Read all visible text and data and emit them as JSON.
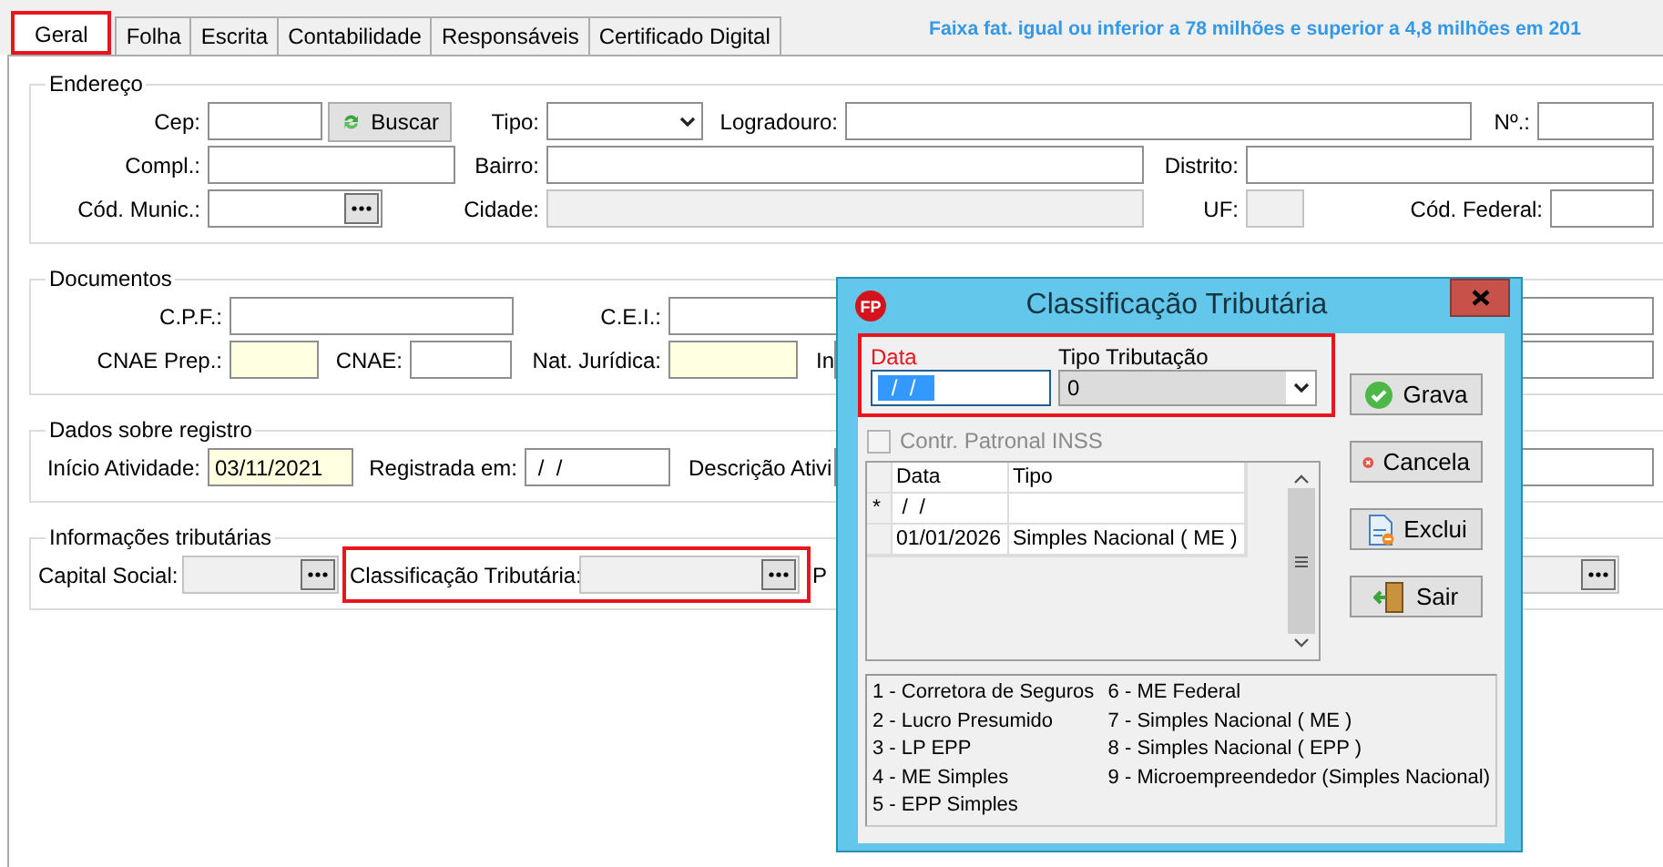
{
  "tabs": [
    {
      "label": "Geral",
      "selected": true,
      "highlighted": true
    },
    {
      "label": "Folha",
      "selected": false,
      "highlighted": false
    },
    {
      "label": "Escrita",
      "selected": false,
      "highlighted": false
    },
    {
      "label": "Contabilidade",
      "selected": false,
      "highlighted": false
    },
    {
      "label": "Responsáveis",
      "selected": false,
      "highlighted": false
    },
    {
      "label": "Certificado Digital",
      "selected": false,
      "highlighted": false
    }
  ],
  "notice": "Faixa fat. igual ou inferior a 78 milhões e superior a 4,8 milhões em 201",
  "groups": [
    {
      "title": "Endereço",
      "fields": [
        {
          "label": "Cep:",
          "kind": "text"
        },
        {
          "label": "Buscar",
          "kind": "button"
        },
        {
          "label": "Tipo:",
          "kind": "select"
        },
        {
          "label": "Logradouro:",
          "kind": "text"
        },
        {
          "label": "Nº.:",
          "kind": "text"
        },
        {
          "label": "Compl.:",
          "kind": "text"
        },
        {
          "label": "Bairro:",
          "kind": "text"
        },
        {
          "label": "Distrito:",
          "kind": "text"
        },
        {
          "label": "Cód. Munic.:",
          "kind": "lookup"
        },
        {
          "label": "Cidade:",
          "kind": "text",
          "disabled": true
        },
        {
          "label": "UF:",
          "kind": "text",
          "disabled": true
        },
        {
          "label": "Cód. Federal:",
          "kind": "text"
        }
      ]
    },
    {
      "title": "Documentos",
      "fields": [
        {
          "label": "C.P.F.:",
          "kind": "text"
        },
        {
          "label": "C.E.I.:",
          "kind": "text"
        },
        {
          "label": "CNAE Prep.:",
          "kind": "text",
          "required": true
        },
        {
          "label": "CNAE:",
          "kind": "text"
        },
        {
          "label": "Nat. Jurídica:",
          "kind": "text",
          "required": true
        },
        {
          "label": "In",
          "kind": "text"
        }
      ]
    },
    {
      "title": "Dados sobre registro",
      "fields": [
        {
          "label": "Início Atividade:",
          "kind": "text",
          "required": true,
          "value": "03/11/2021"
        },
        {
          "label": "Registrada em:",
          "kind": "text",
          "value": " /  /"
        },
        {
          "label": "Descrição Ativi",
          "kind": "text"
        }
      ]
    },
    {
      "title": "Informações tributárias",
      "fields": [
        {
          "label": "Capital Social:",
          "kind": "lookup",
          "disabled": true
        },
        {
          "label": "Classificação Tributária:",
          "kind": "lookup",
          "disabled": true,
          "highlighted": true
        },
        {
          "label": "P",
          "kind": "lookup",
          "disabled": true
        }
      ]
    }
  ],
  "dialog": {
    "icon_text": "FP",
    "title": "Classificação Tributária",
    "highlighted": true,
    "date_field": {
      "label": "Data",
      "value": " /  /",
      "selected": true
    },
    "type_field": {
      "label": "Tipo Tributação",
      "value": "0"
    },
    "checkbox": {
      "label": "Contr. Patronal INSS",
      "checked": false,
      "disabled": true
    },
    "grid": {
      "columns": [
        "Data",
        "Tipo"
      ],
      "rows": [
        {
          "marker": "*",
          "data": " /  /"
        },
        {
          "data": "01/01/2026",
          "tipo": "Simples Nacional ( ME )"
        }
      ]
    },
    "buttons": [
      {
        "label": "Grava",
        "kind": "save"
      },
      {
        "label": "Cancela",
        "kind": "cancel"
      },
      {
        "label": "Exclui",
        "kind": "delete"
      },
      {
        "label": "Sair",
        "kind": "exit"
      }
    ],
    "legend": [
      "1 - Corretora de Seguros",
      "2 - Lucro Presumido",
      "3 - LP EPP",
      "4 - ME Simples",
      "5 - EPP Simples",
      "6 - ME Federal",
      "7 - Simples Nacional ( ME )",
      "8 - Simples Nacional ( EPP )",
      "9 - Microempreendedor (Simples Nacional)"
    ]
  }
}
